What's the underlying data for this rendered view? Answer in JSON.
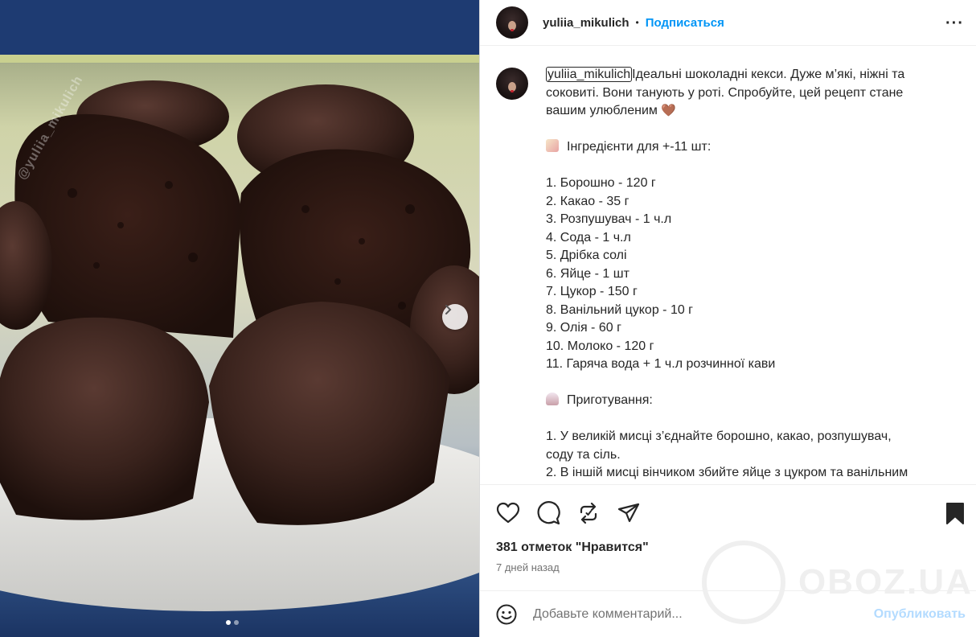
{
  "post": {
    "username": "yuliia_mikulich",
    "separator": "•",
    "follow_label": "Подписаться",
    "more_label": "···",
    "photo_watermark": "@yuliia_mikulich",
    "carousel_next": "›"
  },
  "caption": {
    "username": "yuliia_mikulich",
    "lines": [
      "Ідеальні шоколадні кекси. Дуже м’які, ніжні та",
      "соковиті. Вони танують у роті. Спробуйте, цей рецепт стане",
      "вашим улюбленим",
      "",
      "Інгредієнти для +-11 шт:",
      "",
      "1. Борошно - 120 г",
      "2. Какао - 35 г",
      "3. Розпушувач - 1 ч.л",
      "4. Сода - 1 ч.л",
      "5. Дрібка солі",
      "6. Яйце - 1 шт",
      "7. Цукор - 150 г",
      "8. Ванільний цукор - 10 г",
      "9. Олія - 60 г",
      "10. Молоко - 120 г",
      "11. Гаряча вода + 1 ч.л розчинної кави",
      "",
      "Приготування:",
      "",
      "1. У великій мисці з’єднайте борошно, какао, розпушувач,",
      "соду та сіль.",
      "2. В іншій мисці вінчиком збийте яйце з цукром та ванільним"
    ],
    "heart_emoji": "🤎"
  },
  "icons": {
    "like": "heart-icon",
    "comment": "comment-icon",
    "repost": "repost-icon",
    "share": "share-icon",
    "save": "bookmark-icon"
  },
  "stats": {
    "likes": "381 отметок \"Нравится\"",
    "time": "7 дней назад"
  },
  "watermark": {
    "text": "OBOZ.UA"
  },
  "comment": {
    "placeholder": "Добавьте комментарий...",
    "publish_label": "Опубликовать"
  },
  "colors": {
    "accent": "#0095f6",
    "publish_disabled": "#b3dbff",
    "text": "#262626",
    "muted": "#737373"
  }
}
